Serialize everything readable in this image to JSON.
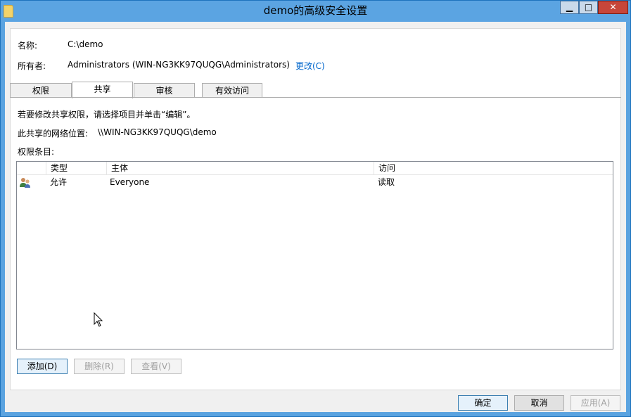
{
  "window": {
    "title": "demo的高级安全设置",
    "controls": {
      "minimize": "▁",
      "maximize": "□",
      "close": "✕"
    }
  },
  "info": {
    "name_label": "名称:",
    "name_value": "C:\\demo",
    "owner_label": "所有者:",
    "owner_value": "Administrators (WIN-NG3KK97QUQG\\Administrators)",
    "change_link": "更改(C)"
  },
  "tabs": [
    {
      "label": "权限",
      "active": false
    },
    {
      "label": "共享",
      "active": true
    },
    {
      "label": "审核",
      "active": false
    },
    {
      "label": "有效访问",
      "active": false
    }
  ],
  "share": {
    "instruction": "若要修改共享权限，请选择项目并单击“编辑”。",
    "network_location_label": "此共享的网络位置:",
    "network_location_value": "\\\\WIN-NG3KK97QUQG\\demo",
    "entries_label": "权限条目:"
  },
  "permissions_table": {
    "columns": [
      "类型",
      "主体",
      "访问"
    ],
    "rows": [
      {
        "icon": "user-group-icon",
        "type": "允许",
        "principal": "Everyone",
        "access": "读取"
      }
    ]
  },
  "list_buttons": {
    "add": "添加(D)",
    "remove": "删除(R)",
    "view": "查看(V)"
  },
  "dialog_buttons": {
    "ok": "确定",
    "cancel": "取消",
    "apply": "应用(A)"
  },
  "colors": {
    "titlebar": "#5ba4e2",
    "link": "#0066cc",
    "close_button": "#c7463a"
  }
}
